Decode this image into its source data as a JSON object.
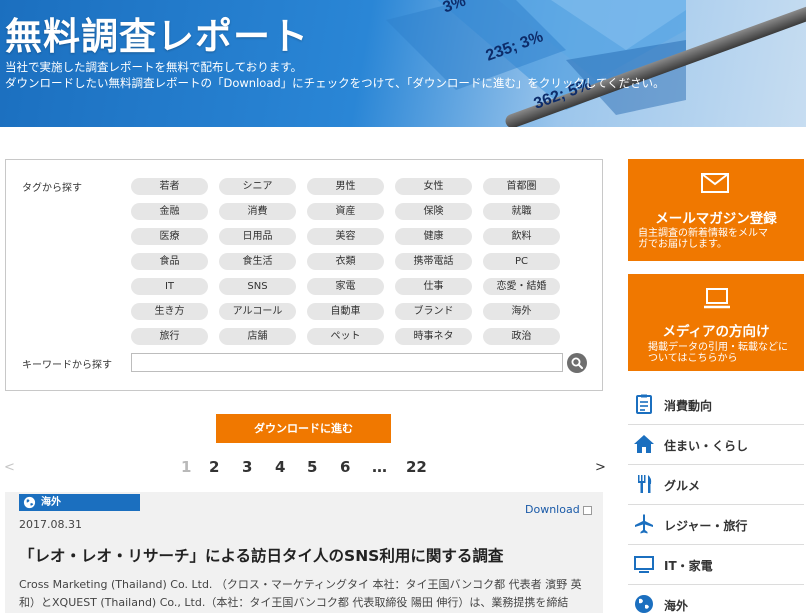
{
  "header": {
    "title": "無料調査レポート",
    "line1": "当社で実施した調査レポートを無料で配布しております。",
    "line2": "ダウンロードしたい無料調査レポートの「Download」にチェックをつけて、「ダウンロードに進む」をクリックしてください。",
    "decor_labels": [
      "3%",
      "235; 3%",
      "362; 5%"
    ]
  },
  "tag_search": {
    "heading": "タグから探す",
    "tags": [
      "若者",
      "シニア",
      "男性",
      "女性",
      "首都圏",
      "金融",
      "消費",
      "資産",
      "保険",
      "就職",
      "医療",
      "日用品",
      "美容",
      "健康",
      "飲料",
      "食品",
      "食生活",
      "衣類",
      "携帯電話",
      "PC",
      "IT",
      "SNS",
      "家電",
      "仕事",
      "恋愛・結婚",
      "生き方",
      "アルコール",
      "自動車",
      "ブランド",
      "海外",
      "旅行",
      "店舗",
      "ペット",
      "時事ネタ",
      "政治"
    ],
    "keyword_label": "キーワードから探す",
    "keyword_value": "",
    "keyword_placeholder": ""
  },
  "download_button_label": "ダウンロードに進む",
  "pagination": {
    "prev": "<",
    "next": ">",
    "current": "1",
    "pages": [
      "1",
      "2",
      "3",
      "4",
      "5",
      "6",
      "…",
      "22"
    ]
  },
  "article": {
    "tag": "海外",
    "date": "2017.08.31",
    "download_label": "Download",
    "title": "「レオ・レオ・リサーチ」による訪日タイ人のSNS利用に関する調査",
    "body_line1": "Cross Marketing (Thailand) Co. Ltd. （クロス・マーケティングタイ 本社：タイ王国バンコク都 代表者 濱野 英",
    "body_line2": "和）とXQUEST (Thailand) Co., Ltd.（本社：タイ王国バンコク都 代表取締役 陽田 伸行）は、業務提携を締結"
  },
  "sidebar": {
    "mail": {
      "title": "メールマガジン登録",
      "sub1": "自主調査の新着情報をメルマ",
      "sub2": "ガでお届けします。"
    },
    "media": {
      "title": "メディアの方向け",
      "sub1": "掲載データの引用・転載などに",
      "sub2": "ついてはこちらから"
    },
    "categories": [
      {
        "label": "消費動向",
        "icon": "clipboard-icon"
      },
      {
        "label": "住まい・くらし",
        "icon": "house-icon"
      },
      {
        "label": "グルメ",
        "icon": "fork-knife-icon"
      },
      {
        "label": "レジャー・旅行",
        "icon": "airplane-icon"
      },
      {
        "label": "IT・家電",
        "icon": "monitor-icon"
      },
      {
        "label": "海外",
        "icon": "globe-icon"
      }
    ]
  },
  "colors": {
    "accent": "#f07800",
    "brand_blue": "#1b6fbf",
    "tag_bg": "#e6e6e6"
  }
}
